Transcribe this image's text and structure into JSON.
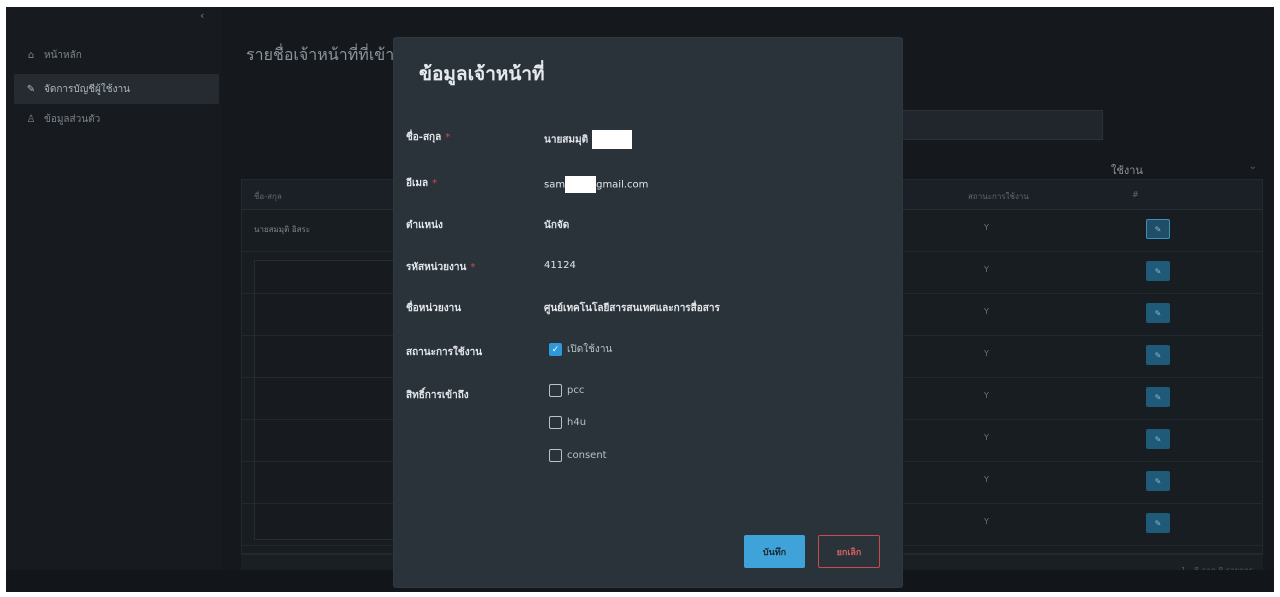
{
  "sidebar": {
    "collapse_icon": "chevron-left-icon",
    "items": [
      {
        "label": "หน้าหลัก",
        "icon": "home-icon"
      },
      {
        "label": "จัดการบัญชีผู้ใช้งาน",
        "icon": "edit-icon"
      },
      {
        "label": "ข้อมูลส่วนตัว",
        "icon": "user-icon"
      }
    ]
  },
  "main": {
    "title": "รายชื่อเจ้าหน้าที่ที่เข้า",
    "status_filter": "ใช้งาน",
    "table": {
      "headers": {
        "name": "ชื่อ-สกุล",
        "status": "สถานะการใช้งาน",
        "action": "#"
      },
      "rows": [
        {
          "name": "นายสมมุติ อิสระ",
          "status": "Y"
        },
        {
          "name": "",
          "status": "Y"
        },
        {
          "name": "",
          "status": "Y"
        },
        {
          "name": "",
          "status": "Y"
        },
        {
          "name": "",
          "status": "Y"
        },
        {
          "name": "",
          "status": "Y"
        },
        {
          "name": "",
          "status": "Y"
        },
        {
          "name": "",
          "status": "Y"
        }
      ],
      "pager": "1 - 8 จาก 8 รายการ"
    }
  },
  "modal": {
    "title": "ข้อมูลเจ้าหน้าที่",
    "fields": {
      "name_label": "ชื่อ-สกุล",
      "name_value": "นายสมมุติ",
      "email_label": "อีเมล",
      "email_prefix": "sam",
      "email_suffix": "gmail.com",
      "position_label": "ตำแหน่ง",
      "position_value": "นักจัด",
      "unit_code_label": "รหัสหน่วยงาน",
      "unit_code_value": "41124",
      "unit_name_label": "ชื่อหน่วยงาน",
      "unit_name_value": "ศูนย์เทคโนโลยีสารสนเทศและการสื่อสาร",
      "status_label": "สถานะการใช้งาน",
      "status_option": "เปิดใช้งาน",
      "access_label": "สิทธิ์การเข้าถึง",
      "access_options": [
        "pcc",
        "h4u",
        "consent"
      ]
    },
    "required_mark": "*",
    "status_checked": true,
    "access_checked": [
      false,
      false,
      false
    ],
    "save_label": "บันทึก",
    "cancel_label": "ยกเลิก"
  },
  "colors": {
    "modal_bg": "#2a3339",
    "accent": "#3fa3d9",
    "danger": "#c74b4b",
    "sidebar_active": "#252b31"
  }
}
